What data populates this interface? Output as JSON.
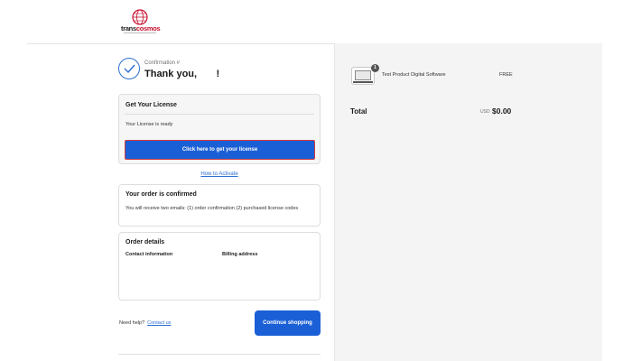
{
  "brand": {
    "name_part1": "trans",
    "name_part2": "cosmos"
  },
  "confirmation": {
    "label": "Confirmation #",
    "heading": "Thank you,       !"
  },
  "license": {
    "title": "Get Your License",
    "status": "Your License is ready",
    "button_label": "Click here to get your license"
  },
  "how_to_activate": "How to Activate",
  "order_confirmed": {
    "title": "Your order is confirmed",
    "description": "You will receive two emails: (1) order confirmation (2) purchased license codes"
  },
  "order_details": {
    "title": "Order details",
    "contact_label": "Contact information",
    "billing_label": "Billing address"
  },
  "help": {
    "text": "Need help?",
    "link": "Contact us"
  },
  "continue_button": "Continue shopping",
  "summary": {
    "product_name": "Test Product Digital Software",
    "quantity": "1",
    "price": "FREE",
    "total_label": "Total",
    "currency": "USD",
    "total_value": "$0.00"
  },
  "colors": {
    "primary": "#1a5fd6",
    "link": "#2d6fd1",
    "highlight_border": "#d03a3a",
    "brand_red": "#c8102e"
  }
}
